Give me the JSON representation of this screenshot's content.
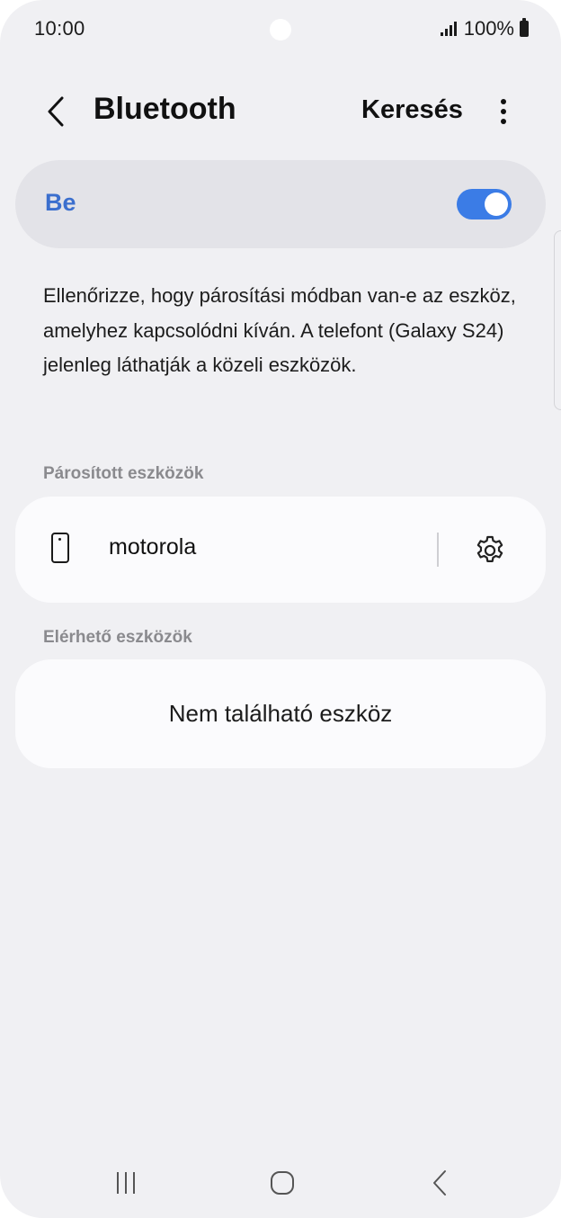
{
  "status_bar": {
    "time": "10:00",
    "battery_text": "100%",
    "icons": [
      "signal-icon",
      "battery-icon"
    ]
  },
  "app_bar": {
    "title": "Bluetooth",
    "search_label": "Keresés",
    "icons": [
      "back-arrow-icon",
      "more-options-icon"
    ]
  },
  "bluetooth_toggle": {
    "label": "Be",
    "state": "on",
    "accent_color": "#3b7ce6",
    "label_color": "#3b6fce"
  },
  "info": {
    "text": "Ellenőrizze, hogy párosítási módban van-e az eszköz, amelyhez kapcsolódni kíván. A telefont (Galaxy S24) jelenleg láthatják a közeli eszközök."
  },
  "paired": {
    "header": "Párosított eszközök",
    "devices": [
      {
        "name": "motorola",
        "icon": "phone-device-icon",
        "settings_icon": "gear-icon"
      }
    ]
  },
  "available": {
    "header": "Elérhető eszközök",
    "empty_text": "Nem található eszköz"
  },
  "nav_bar": {
    "icons": [
      "recent-apps-icon",
      "home-icon",
      "back-icon"
    ]
  }
}
